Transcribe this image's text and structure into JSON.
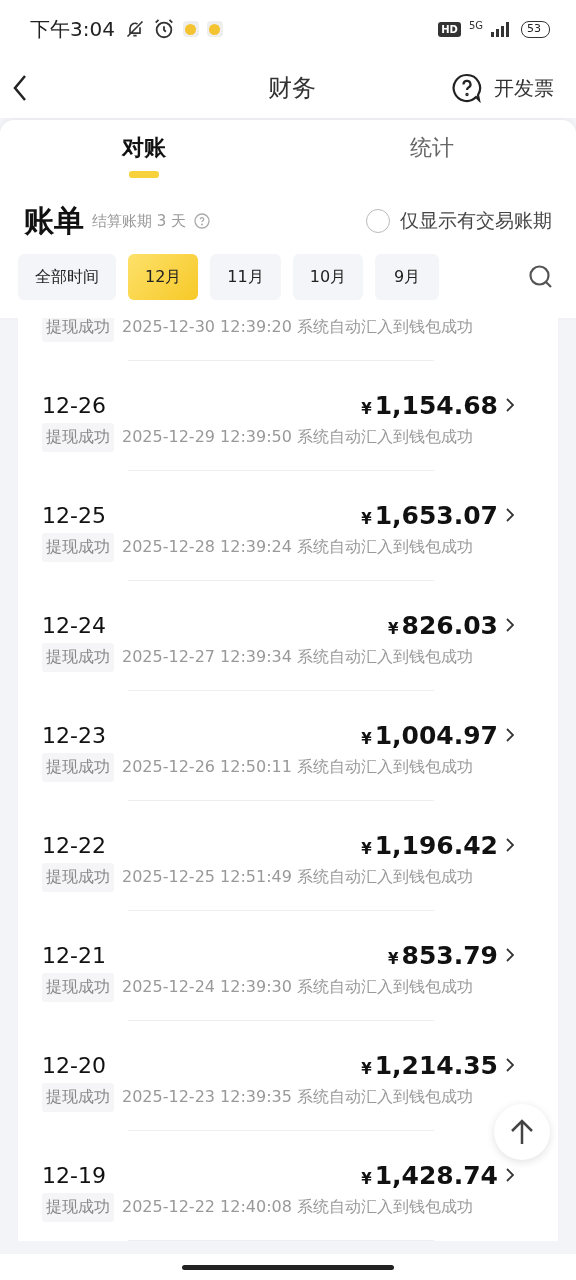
{
  "status_bar": {
    "time": "下午3:04",
    "hd": "HD",
    "network": "5G",
    "battery": "53"
  },
  "nav": {
    "title": "财务",
    "action": "开发票"
  },
  "tabs": [
    {
      "label": "对账",
      "selected": true
    },
    {
      "label": "统计",
      "selected": false
    }
  ],
  "bill": {
    "title": "账单",
    "cycle_note": "结算账期 3 天",
    "filter": {
      "label": "仅显示有交易账期",
      "checked": false
    }
  },
  "periods": [
    {
      "label": "全部时间",
      "selected": false
    },
    {
      "label": "12月",
      "selected": true
    },
    {
      "label": "11月",
      "selected": false
    },
    {
      "label": "10月",
      "selected": false
    },
    {
      "label": "9月",
      "selected": false
    }
  ],
  "records": [
    {
      "status": "提现成功",
      "detail": "2025-12-30 12:39:20 系统自动汇入到钱包成功"
    },
    {
      "date": "12-26",
      "currency": "¥",
      "amount": "1,154.68",
      "status": "提现成功",
      "detail": "2025-12-29 12:39:50 系统自动汇入到钱包成功"
    },
    {
      "date": "12-25",
      "currency": "¥",
      "amount": "1,653.07",
      "status": "提现成功",
      "detail": "2025-12-28 12:39:24 系统自动汇入到钱包成功"
    },
    {
      "date": "12-24",
      "currency": "¥",
      "amount": "826.03",
      "status": "提现成功",
      "detail": "2025-12-27 12:39:34 系统自动汇入到钱包成功"
    },
    {
      "date": "12-23",
      "currency": "¥",
      "amount": "1,004.97",
      "status": "提现成功",
      "detail": "2025-12-26 12:50:11 系统自动汇入到钱包成功"
    },
    {
      "date": "12-22",
      "currency": "¥",
      "amount": "1,196.42",
      "status": "提现成功",
      "detail": "2025-12-25 12:51:49 系统自动汇入到钱包成功"
    },
    {
      "date": "12-21",
      "currency": "¥",
      "amount": "853.79",
      "status": "提现成功",
      "detail": "2025-12-24 12:39:30 系统自动汇入到钱包成功"
    },
    {
      "date": "12-20",
      "currency": "¥",
      "amount": "1,214.35",
      "status": "提现成功",
      "detail": "2025-12-23 12:39:35 系统自动汇入到钱包成功"
    },
    {
      "date": "12-19",
      "currency": "¥",
      "amount": "1,428.74",
      "status": "提现成功",
      "detail": "2025-12-22 12:40:08 系统自动汇入到钱包成功"
    }
  ]
}
